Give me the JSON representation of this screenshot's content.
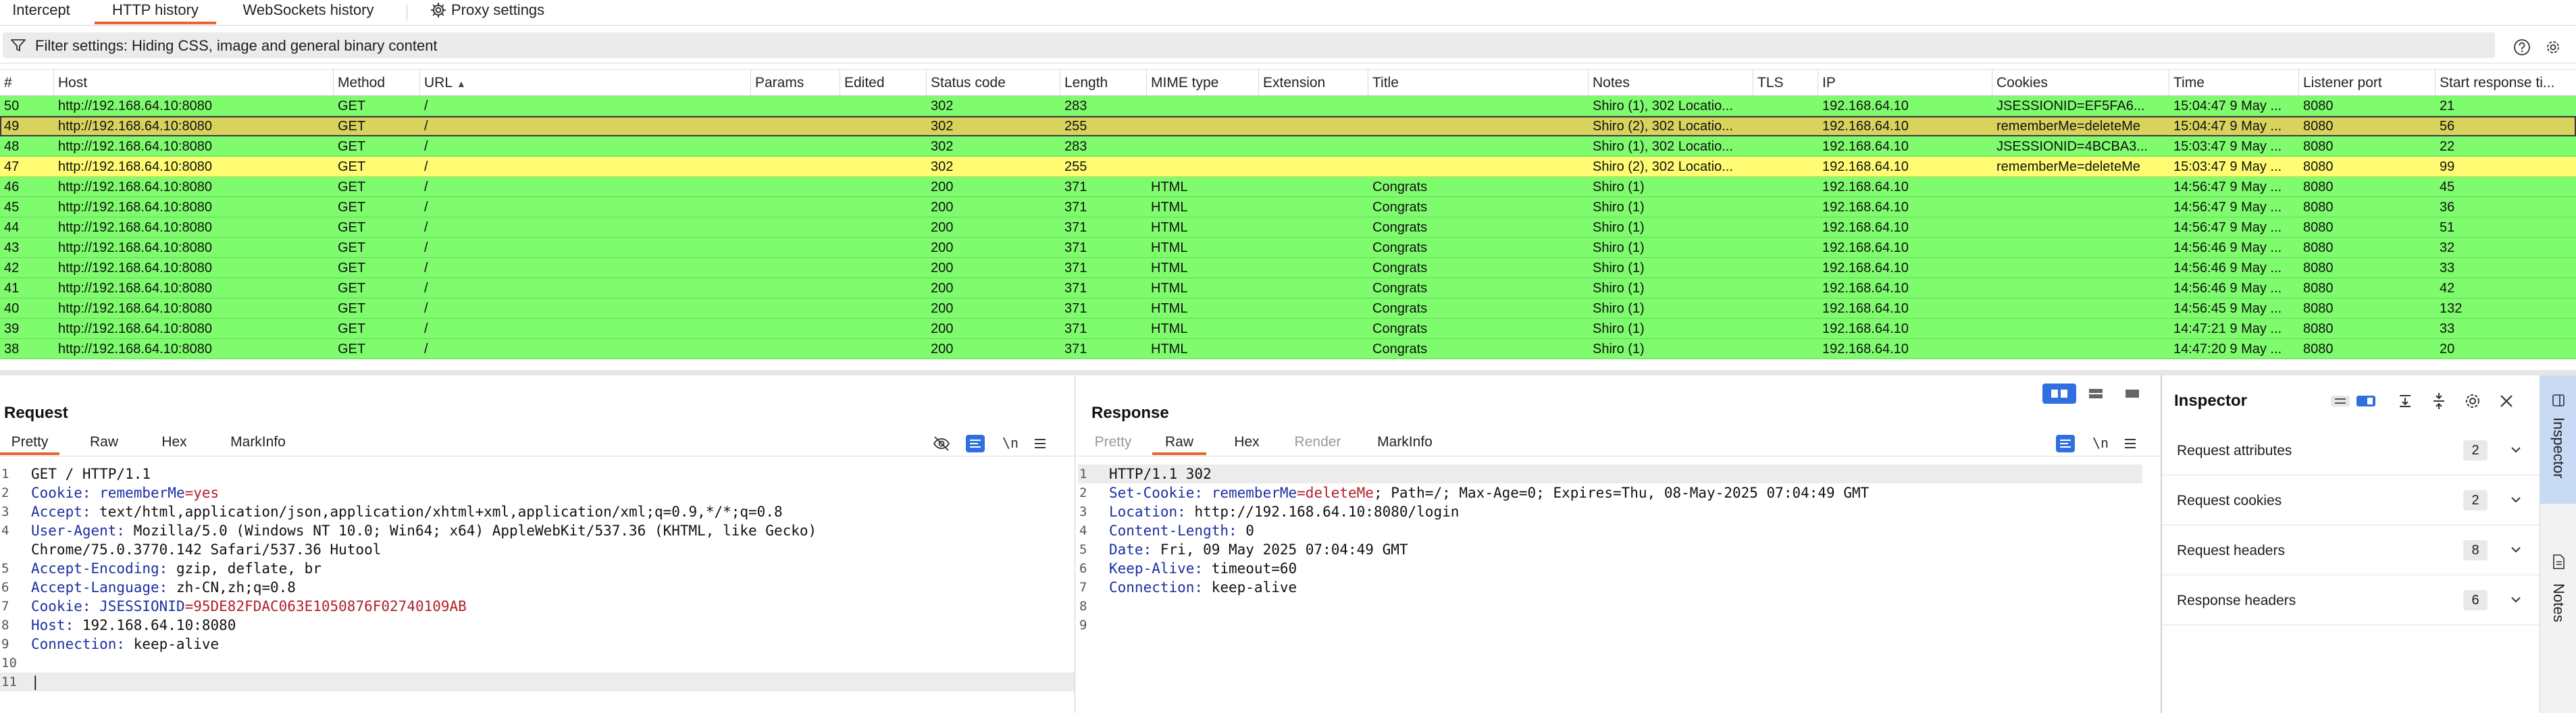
{
  "top_tabs": [
    {
      "label": "Intercept"
    },
    {
      "label": "HTTP history"
    },
    {
      "label": "WebSockets history"
    },
    {
      "label": "Proxy settings"
    }
  ],
  "filter": {
    "text": "Filter settings: Hiding CSS, image and general binary content"
  },
  "table": {
    "columns": [
      "#",
      "Host",
      "Method",
      "URL",
      "Params",
      "Edited",
      "Status code",
      "Length",
      "MIME type",
      "Extension",
      "Title",
      "Notes",
      "TLS",
      "IP",
      "Cookies",
      "Time",
      "Listener port",
      "Start response ti..."
    ],
    "rows": [
      {
        "num": "50",
        "host": "http://192.168.64.10:8080",
        "method": "GET",
        "url": "/",
        "status": "302",
        "length": "283",
        "mime": "",
        "title": "",
        "notes": "Shiro (1), 302 Locatio...",
        "ip": "192.168.64.10",
        "cookies": "JSESSIONID=EF5FA6...",
        "time": "15:04:47 9 May ...",
        "port": "8080",
        "start": "21",
        "color": "green"
      },
      {
        "num": "49",
        "host": "http://192.168.64.10:8080",
        "method": "GET",
        "url": "/",
        "status": "302",
        "length": "255",
        "mime": "",
        "title": "",
        "notes": "Shiro (2), 302 Locatio...",
        "ip": "192.168.64.10",
        "cookies": "rememberMe=deleteMe",
        "time": "15:04:47 9 May ...",
        "port": "8080",
        "start": "56",
        "color": "selected"
      },
      {
        "num": "48",
        "host": "http://192.168.64.10:8080",
        "method": "GET",
        "url": "/",
        "status": "302",
        "length": "283",
        "mime": "",
        "title": "",
        "notes": "Shiro (1), 302 Locatio...",
        "ip": "192.168.64.10",
        "cookies": "JSESSIONID=4BCBA3...",
        "time": "15:03:47 9 May ...",
        "port": "8080",
        "start": "22",
        "color": "green"
      },
      {
        "num": "47",
        "host": "http://192.168.64.10:8080",
        "method": "GET",
        "url": "/",
        "status": "302",
        "length": "255",
        "mime": "",
        "title": "",
        "notes": "Shiro (2), 302 Locatio...",
        "ip": "192.168.64.10",
        "cookies": "rememberMe=deleteMe",
        "time": "15:03:47 9 May ...",
        "port": "8080",
        "start": "99",
        "color": "yellow"
      },
      {
        "num": "46",
        "host": "http://192.168.64.10:8080",
        "method": "GET",
        "url": "/",
        "status": "200",
        "length": "371",
        "mime": "HTML",
        "title": "Congrats",
        "notes": "Shiro (1)",
        "ip": "192.168.64.10",
        "cookies": "",
        "time": "14:56:47 9 May ...",
        "port": "8080",
        "start": "45",
        "color": "green"
      },
      {
        "num": "45",
        "host": "http://192.168.64.10:8080",
        "method": "GET",
        "url": "/",
        "status": "200",
        "length": "371",
        "mime": "HTML",
        "title": "Congrats",
        "notes": "Shiro (1)",
        "ip": "192.168.64.10",
        "cookies": "",
        "time": "14:56:47 9 May ...",
        "port": "8080",
        "start": "36",
        "color": "green"
      },
      {
        "num": "44",
        "host": "http://192.168.64.10:8080",
        "method": "GET",
        "url": "/",
        "status": "200",
        "length": "371",
        "mime": "HTML",
        "title": "Congrats",
        "notes": "Shiro (1)",
        "ip": "192.168.64.10",
        "cookies": "",
        "time": "14:56:47 9 May ...",
        "port": "8080",
        "start": "51",
        "color": "green"
      },
      {
        "num": "43",
        "host": "http://192.168.64.10:8080",
        "method": "GET",
        "url": "/",
        "status": "200",
        "length": "371",
        "mime": "HTML",
        "title": "Congrats",
        "notes": "Shiro (1)",
        "ip": "192.168.64.10",
        "cookies": "",
        "time": "14:56:46 9 May ...",
        "port": "8080",
        "start": "32",
        "color": "green"
      },
      {
        "num": "42",
        "host": "http://192.168.64.10:8080",
        "method": "GET",
        "url": "/",
        "status": "200",
        "length": "371",
        "mime": "HTML",
        "title": "Congrats",
        "notes": "Shiro (1)",
        "ip": "192.168.64.10",
        "cookies": "",
        "time": "14:56:46 9 May ...",
        "port": "8080",
        "start": "33",
        "color": "green"
      },
      {
        "num": "41",
        "host": "http://192.168.64.10:8080",
        "method": "GET",
        "url": "/",
        "status": "200",
        "length": "371",
        "mime": "HTML",
        "title": "Congrats",
        "notes": "Shiro (1)",
        "ip": "192.168.64.10",
        "cookies": "",
        "time": "14:56:46 9 May ...",
        "port": "8080",
        "start": "42",
        "color": "green"
      },
      {
        "num": "40",
        "host": "http://192.168.64.10:8080",
        "method": "GET",
        "url": "/",
        "status": "200",
        "length": "371",
        "mime": "HTML",
        "title": "Congrats",
        "notes": "Shiro (1)",
        "ip": "192.168.64.10",
        "cookies": "",
        "time": "14:56:45 9 May ...",
        "port": "8080",
        "start": "132",
        "color": "green"
      },
      {
        "num": "39",
        "host": "http://192.168.64.10:8080",
        "method": "GET",
        "url": "/",
        "status": "200",
        "length": "371",
        "mime": "HTML",
        "title": "Congrats",
        "notes": "Shiro (1)",
        "ip": "192.168.64.10",
        "cookies": "",
        "time": "14:47:21 9 May ...",
        "port": "8080",
        "start": "33",
        "color": "green"
      },
      {
        "num": "38",
        "host": "http://192.168.64.10:8080",
        "method": "GET",
        "url": "/",
        "status": "200",
        "length": "371",
        "mime": "HTML",
        "title": "Congrats",
        "notes": "Shiro (1)",
        "ip": "192.168.64.10",
        "cookies": "",
        "time": "14:47:20 9 May ...",
        "port": "8080",
        "start": "20",
        "color": "green"
      }
    ]
  },
  "request": {
    "title": "Request",
    "tabs": [
      "Pretty",
      "Raw",
      "Hex",
      "MarkInfo"
    ],
    "active_tab": "Pretty",
    "newline_label": "\\n",
    "lines": [
      {
        "n": "1",
        "segs": [
          {
            "t": "GET / HTTP/1.1",
            "c": ""
          }
        ]
      },
      {
        "n": "2",
        "segs": [
          {
            "t": "Cookie: ",
            "c": "hn"
          },
          {
            "t": "rememberMe",
            "c": "hn"
          },
          {
            "t": "=yes",
            "c": "kv"
          }
        ]
      },
      {
        "n": "3",
        "segs": [
          {
            "t": "Accept: ",
            "c": "hn"
          },
          {
            "t": "text/html,application/json,application/xhtml+xml,application/xml;q=0.9,*/*;q=0.8",
            "c": ""
          }
        ]
      },
      {
        "n": "4",
        "segs": [
          {
            "t": "User-Agent: ",
            "c": "hn"
          },
          {
            "t": "Mozilla/5.0 (Windows NT 10.0; Win64; x64) AppleWebKit/537.36 (KHTML, like Gecko)",
            "c": ""
          }
        ]
      },
      {
        "n": "",
        "segs": [
          {
            "t": "Chrome/75.0.3770.142 Safari/537.36 Hutool",
            "c": ""
          }
        ]
      },
      {
        "n": "5",
        "segs": [
          {
            "t": "Accept-Encoding: ",
            "c": "hn"
          },
          {
            "t": "gzip, deflate, br",
            "c": ""
          }
        ]
      },
      {
        "n": "6",
        "segs": [
          {
            "t": "Accept-Language: ",
            "c": "hn"
          },
          {
            "t": "zh-CN,zh;q=0.8",
            "c": ""
          }
        ]
      },
      {
        "n": "7",
        "segs": [
          {
            "t": "Cookie: ",
            "c": "hn"
          },
          {
            "t": "JSESSIONID",
            "c": "hn"
          },
          {
            "t": "=95DE82FDAC063E1050876F02740109AB",
            "c": "kv"
          }
        ]
      },
      {
        "n": "8",
        "segs": [
          {
            "t": "Host: ",
            "c": "hn"
          },
          {
            "t": "192.168.64.10:8080",
            "c": ""
          }
        ]
      },
      {
        "n": "9",
        "segs": [
          {
            "t": "Connection: ",
            "c": "hn"
          },
          {
            "t": "keep-alive",
            "c": ""
          }
        ]
      },
      {
        "n": "10",
        "segs": [
          {
            "t": "",
            "c": ""
          }
        ]
      },
      {
        "n": "11",
        "segs": [
          {
            "t": "|",
            "c": ""
          }
        ],
        "hl": true
      }
    ]
  },
  "response": {
    "title": "Response",
    "tabs": [
      "Pretty",
      "Raw",
      "Hex",
      "Render",
      "MarkInfo"
    ],
    "active_tab": "Raw",
    "newline_label": "\\n",
    "lines": [
      {
        "n": "1",
        "segs": [
          {
            "t": "HTTP/1.1 302",
            "c": ""
          }
        ],
        "hl": true
      },
      {
        "n": "2",
        "segs": [
          {
            "t": "Set-Cookie: ",
            "c": "hn"
          },
          {
            "t": "rememberMe",
            "c": "hn"
          },
          {
            "t": "=deleteMe",
            "c": "kv"
          },
          {
            "t": "; Path=/; Max-Age=0; Expires=Thu, 08-May-2025 07:04:49 GMT",
            "c": ""
          }
        ]
      },
      {
        "n": "3",
        "segs": [
          {
            "t": "Location: ",
            "c": "hn"
          },
          {
            "t": "http://192.168.64.10:8080/login",
            "c": ""
          }
        ]
      },
      {
        "n": "4",
        "segs": [
          {
            "t": "Content-Length: ",
            "c": "hn"
          },
          {
            "t": "0",
            "c": ""
          }
        ]
      },
      {
        "n": "5",
        "segs": [
          {
            "t": "Date: ",
            "c": "hn"
          },
          {
            "t": "Fri, 09 May 2025 07:04:49 GMT",
            "c": ""
          }
        ]
      },
      {
        "n": "6",
        "segs": [
          {
            "t": "Keep-Alive: ",
            "c": "hn"
          },
          {
            "t": "timeout=60",
            "c": ""
          }
        ]
      },
      {
        "n": "7",
        "segs": [
          {
            "t": "Connection: ",
            "c": "hn"
          },
          {
            "t": "keep-alive",
            "c": ""
          }
        ]
      },
      {
        "n": "8",
        "segs": [
          {
            "t": "",
            "c": ""
          }
        ]
      },
      {
        "n": "9",
        "segs": [
          {
            "t": "",
            "c": ""
          }
        ]
      }
    ]
  },
  "inspector": {
    "title": "Inspector",
    "sections": [
      {
        "label": "Request attributes",
        "count": "2"
      },
      {
        "label": "Request cookies",
        "count": "2"
      },
      {
        "label": "Request headers",
        "count": "8"
      },
      {
        "label": "Response headers",
        "count": "6"
      }
    ]
  },
  "side_rail": {
    "inspector_label": "Inspector",
    "notes_label": "Notes"
  },
  "colors": {
    "row_green": "#7ffb6e",
    "row_yellow": "#fffc73",
    "row_selected": "#d9d35e",
    "accent": "#e8652f",
    "blue": "#2f6fe0"
  }
}
